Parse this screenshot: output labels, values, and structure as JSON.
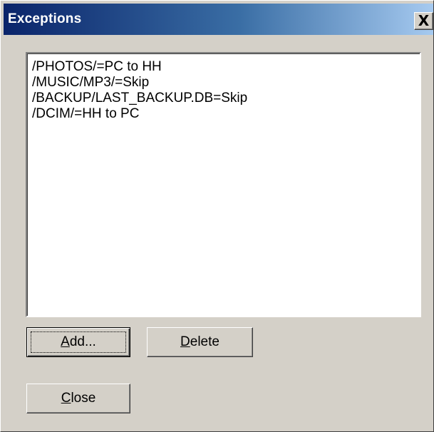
{
  "window": {
    "title": "Exceptions",
    "close_glyph": "X"
  },
  "exceptions_list": {
    "items": [
      "/PHOTOS/=PC to HH",
      "/MUSIC/MP3/=Skip",
      "/BACKUP/LAST_BACKUP.DB=Skip",
      "/DCIM/=HH to PC"
    ]
  },
  "buttons": {
    "add": {
      "accel": "A",
      "rest": "dd..."
    },
    "delete": {
      "accel": "D",
      "rest": "elete"
    },
    "close": {
      "accel": "C",
      "rest": "lose"
    }
  },
  "colors": {
    "dialog_face": "#d4d0c8",
    "titlebar_start": "#0a246a",
    "titlebar_end": "#a6caf0",
    "list_background": "#ffffff"
  },
  "icons": {
    "close": "close-icon"
  }
}
